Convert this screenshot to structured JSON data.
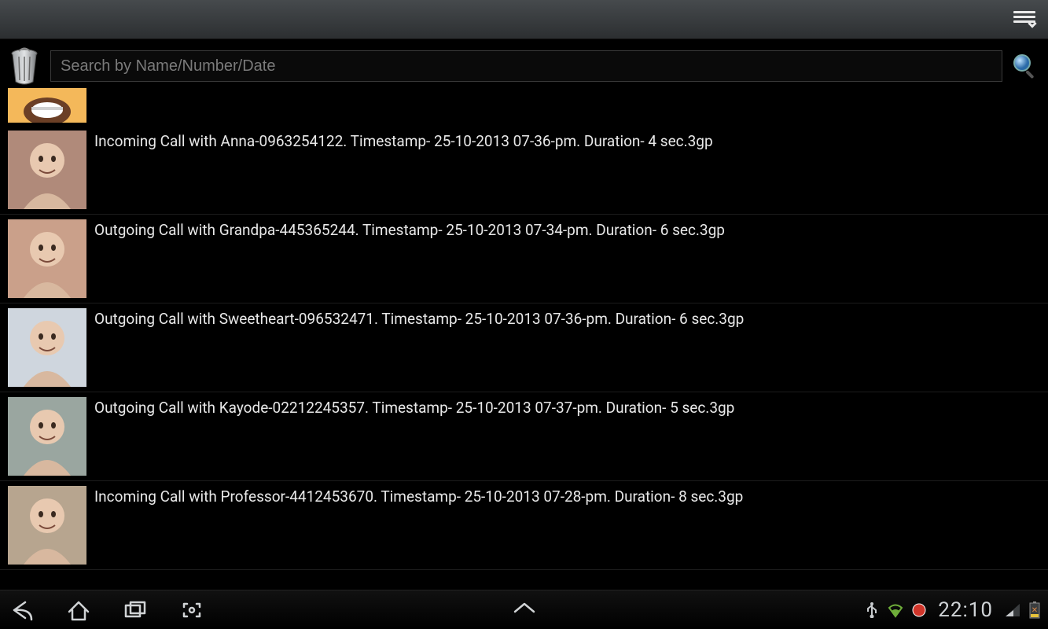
{
  "topbar": {
    "menu_icon_name": "overflow-menu"
  },
  "toolbar": {
    "trash_icon_name": "trash",
    "search_placeholder": "Search by Name/Number/Date",
    "search_icon_name": "magnifier"
  },
  "small_avatar": {
    "bg": "#f4b85a",
    "desc": "contact-thumbnail"
  },
  "calls": [
    {
      "text": "Incoming Call with Anna-0963254122. Timestamp- 25-10-2013 07-36-pm. Duration- 4 sec.3gp",
      "avatar_bg": "#b08a7a",
      "avatar_desc": "contact Anna"
    },
    {
      "text": "Outgoing Call with Grandpa-445365244. Timestamp- 25-10-2013 07-34-pm. Duration- 6 sec.3gp",
      "avatar_bg": "#caa08a",
      "avatar_desc": "contact Grandpa"
    },
    {
      "text": "Outgoing Call with Sweetheart-096532471. Timestamp- 25-10-2013 07-36-pm. Duration- 6 sec.3gp",
      "avatar_bg": "#cfd6de",
      "avatar_desc": "contact Sweetheart"
    },
    {
      "text": "Outgoing Call with Kayode-02212245357. Timestamp- 25-10-2013 07-37-pm. Duration- 5 sec.3gp",
      "avatar_bg": "#9aa6a0",
      "avatar_desc": "contact Kayode"
    },
    {
      "text": "Incoming Call with Professor-4412453670. Timestamp- 25-10-2013 07-28-pm. Duration- 8 sec.3gp",
      "avatar_bg": "#b7a58f",
      "avatar_desc": "contact Professor"
    }
  ],
  "navbar": {
    "clock": "22:10",
    "icons": {
      "back": "back",
      "home": "home",
      "recent": "recent-apps",
      "screenshot": "screenshot",
      "expand": "expand-up",
      "usb": "usb",
      "wifi": "wifi",
      "record": "record",
      "signal": "cellular-signal",
      "battery": "battery-low"
    }
  }
}
